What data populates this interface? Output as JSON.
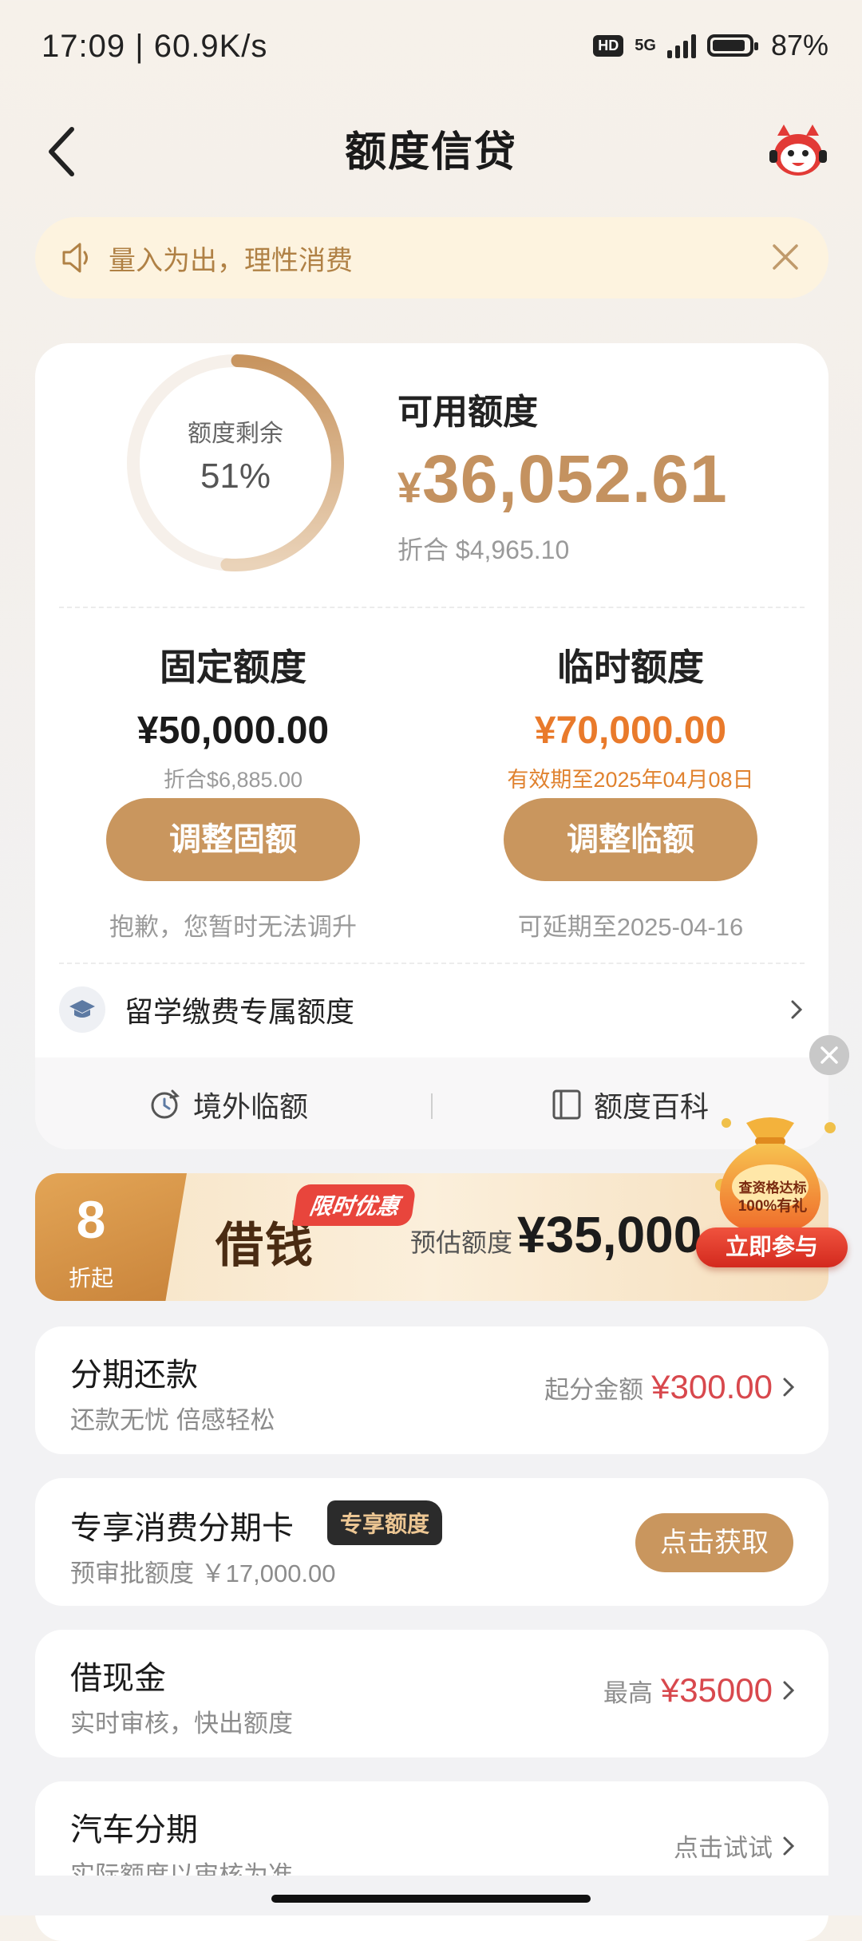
{
  "status_bar": {
    "time": "17:09 | 60.9K/s",
    "hd": "HD",
    "network": "5G",
    "battery": "87%"
  },
  "header": {
    "title": "额度信贷"
  },
  "notice": {
    "text": "量入为出，理性消费"
  },
  "quota": {
    "ring_label": "额度剩余",
    "ring_percent": "51%",
    "ring_fraction": 0.51,
    "available_label": "可用额度",
    "available_currency": "¥",
    "available_amount": "36,052.61",
    "available_equiv": "折合 $4,965.10"
  },
  "fixed": {
    "title": "固定额度",
    "amount": "¥50,000.00",
    "equiv": "折合$6,885.00",
    "button": "调整固额",
    "note": "抱歉，您暂时无法调升"
  },
  "temp": {
    "title": "临时额度",
    "amount": "¥70,000.00",
    "validity": "有效期至2025年04月08日",
    "button": "调整临额",
    "note": "可延期至2025-04-16"
  },
  "study": {
    "label": "留学缴费专属额度"
  },
  "footer_links": {
    "left": "境外临额",
    "right": "额度百科"
  },
  "promo": {
    "discount_number": "8",
    "discount_suffix": "折起",
    "tag": "限时优惠",
    "title": "借钱",
    "estimate_label": "预估额度",
    "estimate_amount": "¥35,000",
    "bag_line1": "查资格达标",
    "bag_line2": "100%有礼",
    "join_button": "立即参与"
  },
  "installment": {
    "title": "分期还款",
    "subtitle": "还款无忧 倍感轻松",
    "right_label": "起分金额",
    "right_amount": "¥300.00"
  },
  "card_exclusive": {
    "title": "专享消费分期卡",
    "badge": "专享额度",
    "subtitle": "预审批额度 ￥17,000.00",
    "button": "点击获取"
  },
  "cash_loan": {
    "title": "借现金",
    "subtitle": "实时审核，快出额度",
    "right_label": "最高",
    "right_amount": "¥35000"
  },
  "car_loan": {
    "title": "汽车分期",
    "subtitle": "实际额度以审核为准",
    "right_label": "点击试试"
  },
  "colors": {
    "gold": "#c9965e",
    "orange": "#e97a2b",
    "red": "#d8484d",
    "notice_bg": "#fdf3df"
  }
}
